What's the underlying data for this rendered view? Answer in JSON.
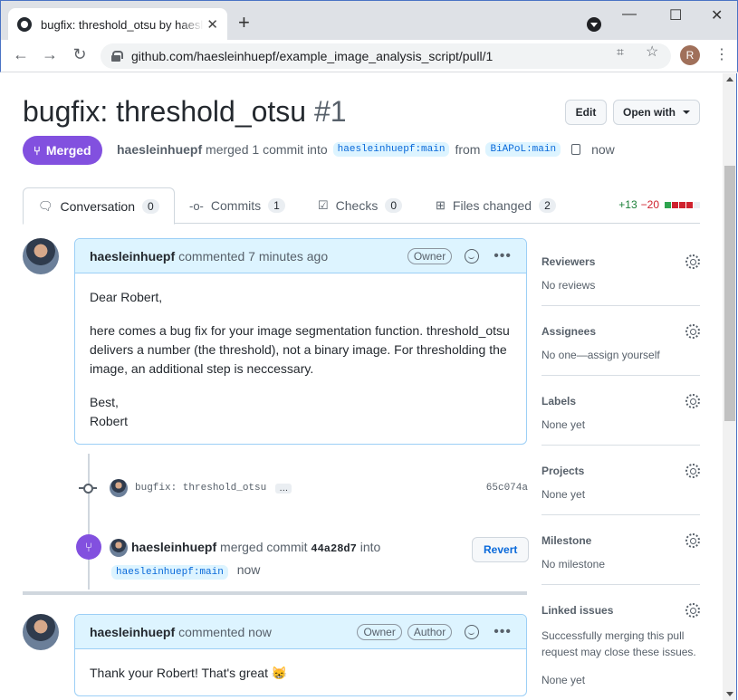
{
  "browser": {
    "tab_title": "bugfix: threshold_otsu by haesleinhuepf",
    "tab_close": "✕",
    "new_tab": "+",
    "url": "github.com/haesleinhuepf/example_image_analysis_script/pull/1",
    "profile_initial": "R",
    "window_controls": {
      "minimize": "—",
      "maximize": "☐",
      "close": "✕"
    },
    "nav": {
      "back": "←",
      "forward": "→",
      "reload": "↻",
      "menu": "⋮",
      "star": "☆",
      "translate": "⌗"
    }
  },
  "pr": {
    "title": "bugfix: threshold_otsu",
    "number": "#1",
    "edit_label": "Edit",
    "open_with_label": "Open with",
    "state_label": "Merged",
    "merged_by": "haesleinhuepf",
    "merged_text": "merged 1 commit into",
    "base_branch": "haesleinhuepf:main",
    "from_text": "from",
    "head_branch": "BiAPoL:main",
    "time": "now"
  },
  "tabs": [
    {
      "label": "Conversation",
      "count": "0"
    },
    {
      "label": "Commits",
      "count": "1"
    },
    {
      "label": "Checks",
      "count": "0"
    },
    {
      "label": "Files changed",
      "count": "2"
    }
  ],
  "diffstat": {
    "additions": "+13",
    "deletions": "−20",
    "colors": [
      "#2da44e",
      "#cf222e",
      "#cf222e",
      "#cf222e",
      "#eaeef2"
    ]
  },
  "timeline": {
    "comment1": {
      "author": "haesleinhuepf",
      "action": "commented 7 minutes ago",
      "badge": "Owner",
      "paragraphs": [
        "Dear Robert,",
        "here comes a bug fix for your image segmentation function. threshold_otsu delivers a number (the threshold), not a binary image. For thresholding the image, an additional step is neccessary."
      ],
      "closing": "Best,",
      "signature": "Robert"
    },
    "commit": {
      "message": "bugfix: threshold_otsu",
      "ellipsis": "…",
      "sha": "65c074a"
    },
    "merge": {
      "user": "haesleinhuepf",
      "text": "merged commit",
      "sha": "44a28d7",
      "into": "into",
      "branch": "haesleinhuepf:main",
      "time": "now",
      "revert_label": "Revert"
    },
    "comment2": {
      "author": "haesleinhuepf",
      "action": "commented now",
      "badge_owner": "Owner",
      "badge_author": "Author",
      "body": "Thank your Robert! That's great",
      "emoji": "😸"
    }
  },
  "sidebar": {
    "reviewers": {
      "title": "Reviewers",
      "value": "No reviews"
    },
    "assignees": {
      "title": "Assignees",
      "value": "No one—assign yourself"
    },
    "labels": {
      "title": "Labels",
      "value": "None yet"
    },
    "projects": {
      "title": "Projects",
      "value": "None yet"
    },
    "milestone": {
      "title": "Milestone",
      "value": "No milestone"
    },
    "linked_issues": {
      "title": "Linked issues",
      "description": "Successfully merging this pull request may close these issues.",
      "value": "None yet"
    }
  }
}
